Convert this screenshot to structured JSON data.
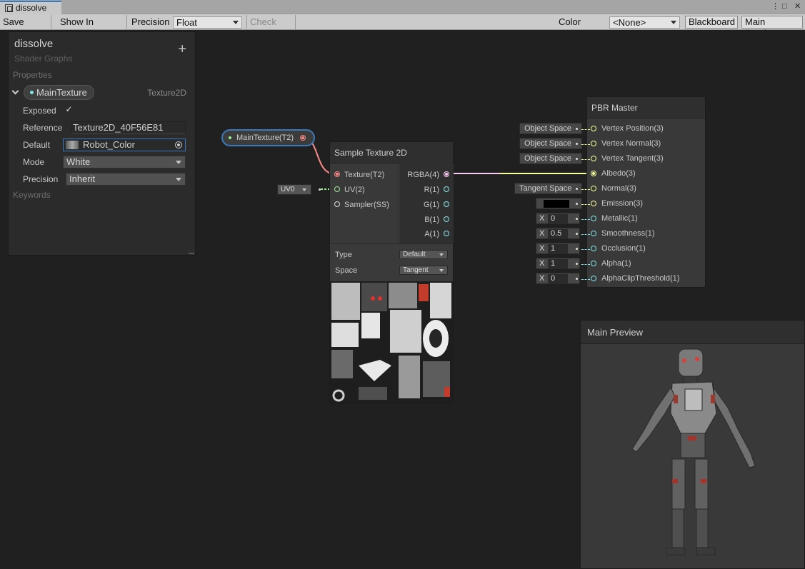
{
  "window": {
    "tab_title": "dissolve",
    "menu_glyph": "⋮",
    "maximize_glyph": "□",
    "close_glyph": "✕"
  },
  "toolbar": {
    "save_asset": "Save Asset",
    "show_in_project": "Show In Project",
    "precision_label": "Precision",
    "precision_value": "Float",
    "check_out": "Check Out",
    "color_mode_label": "Color Mode",
    "color_mode_value": "<None>",
    "blackboard": "Blackboard",
    "main_preview": "Main Preview"
  },
  "blackboard": {
    "title": "dissolve",
    "subtitle": "Shader Graphs",
    "add_glyph": "+",
    "properties_header": "Properties",
    "property": {
      "name": "MainTexture",
      "type": "Texture2D",
      "exposed_label": "Exposed",
      "exposed_check": "✓",
      "reference_label": "Reference",
      "reference_value": "Texture2D_40F56E81",
      "default_label": "Default",
      "default_value": "Robot_Color",
      "mode_label": "Mode",
      "mode_value": "White",
      "precision_label": "Precision",
      "precision_value": "Inherit"
    },
    "keywords_header": "Keywords"
  },
  "property_node": {
    "label": "MainTexture(T2)"
  },
  "uv_node": {
    "label": "UV0"
  },
  "sample_node": {
    "title": "Sample Texture 2D",
    "inputs": [
      "Texture(T2)",
      "UV(2)",
      "Sampler(SS)"
    ],
    "outputs": [
      "RGBA(4)",
      "R(1)",
      "G(1)",
      "B(1)",
      "A(1)"
    ],
    "type_label": "Type",
    "type_value": "Default",
    "space_label": "Space",
    "space_value": "Tangent"
  },
  "pbr_master": {
    "title": "PBR Master",
    "ports": [
      "Vertex Position(3)",
      "Vertex Normal(3)",
      "Vertex Tangent(3)",
      "Albedo(3)",
      "Normal(3)",
      "Emission(3)",
      "Metallic(1)",
      "Smoothness(1)",
      "Occlusion(1)",
      "Alpha(1)",
      "AlphaClipThreshold(1)"
    ],
    "space_inputs": [
      "Object Space",
      "Object Space",
      "Object Space"
    ],
    "normal_space": "Tangent Space",
    "x_label": "X",
    "metallic": "0",
    "smoothness": "0.5",
    "occlusion": "1",
    "alpha": "1",
    "alpha_clip": "0"
  },
  "preview": {
    "title": "Main Preview"
  },
  "colors": {
    "accent": "#3a79bb",
    "texture_port": "#ff8b8b",
    "vector2_port": "#9aef92",
    "vector3_port": "#f6ff9a",
    "vector4_port": "#fbcbf4",
    "float_port": "#84e4e7",
    "sampler_port": "#dcdcdc"
  }
}
